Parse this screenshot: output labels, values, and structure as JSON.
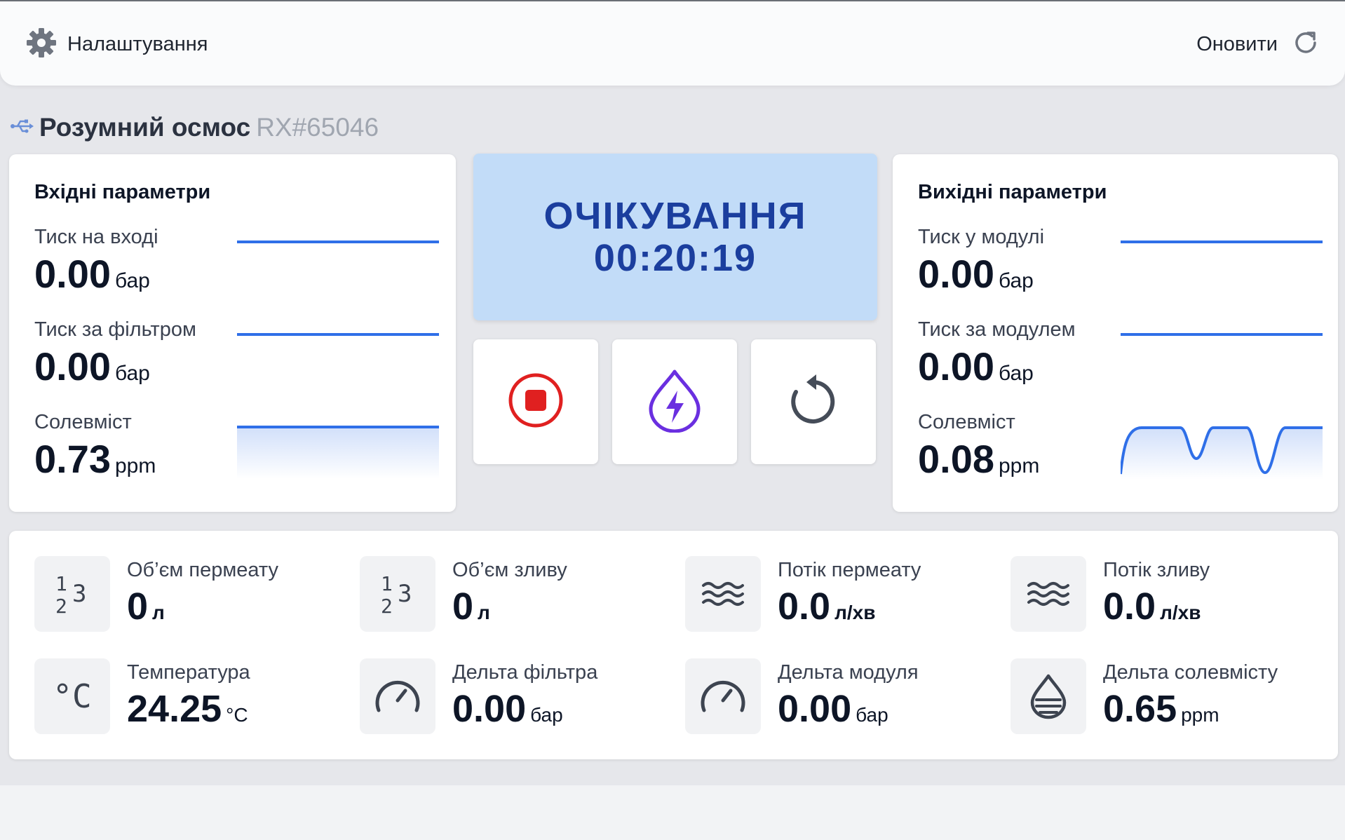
{
  "header": {
    "settings_label": "Налаштування",
    "refresh_label": "Оновити"
  },
  "device": {
    "name": "Розумний осмос",
    "id": "RX#65046"
  },
  "input_params": {
    "title": "Вхідні параметри",
    "items": [
      {
        "label": "Тиск на вході",
        "value": "0.00",
        "unit": "бар"
      },
      {
        "label": "Тиск за фільтром",
        "value": "0.00",
        "unit": "бар"
      },
      {
        "label": "Солевміст",
        "value": "0.73",
        "unit": "ppm"
      }
    ]
  },
  "output_params": {
    "title": "Вихідні параметри",
    "items": [
      {
        "label": "Тиск у модулі",
        "value": "0.00",
        "unit": "бар"
      },
      {
        "label": "Тиск за модулем",
        "value": "0.00",
        "unit": "бар"
      },
      {
        "label": "Солевміст",
        "value": "0.08",
        "unit": "ppm"
      }
    ]
  },
  "status": {
    "state": "ОЧІКУВАННЯ",
    "timer": "00:20:19"
  },
  "controls": [
    {
      "icon": "stop-circle-icon",
      "color": "#e02020"
    },
    {
      "icon": "flush-drop-bolt-icon",
      "color": "#6a2fe0"
    },
    {
      "icon": "reset-rotate-icon",
      "color": "#454c58"
    }
  ],
  "metrics": [
    {
      "icon": "counter-123-icon",
      "icon_text": "123",
      "label": "Об’єм пермеату",
      "value": "0",
      "unit": "л"
    },
    {
      "icon": "counter-123-icon",
      "icon_text": "123",
      "label": "Об’єм зливу",
      "value": "0",
      "unit": "л"
    },
    {
      "icon": "waves-icon",
      "label": "Потік пермеату",
      "value": "0.0",
      "unit": "л/хв"
    },
    {
      "icon": "waves-icon",
      "label": "Потік зливу",
      "value": "0.0",
      "unit": "л/хв"
    },
    {
      "icon": "thermometer-celsius-icon",
      "icon_text": "°C",
      "label": "Температура",
      "value": "24.25",
      "unit": "°C"
    },
    {
      "icon": "gauge-icon",
      "label": "Дельта фільтра",
      "value": "0.00",
      "unit": "бар"
    },
    {
      "icon": "gauge-icon",
      "label": "Дельта модуля",
      "value": "0.00",
      "unit": "бар"
    },
    {
      "icon": "water-drop-icon",
      "label": "Дельта солевмісту",
      "value": "0.65",
      "unit": "ppm"
    }
  ],
  "colors": {
    "accent": "#1b3e9e",
    "status_bg": "#c2dcf8",
    "sparkline": "#2f6fe8",
    "stop": "#e02020",
    "flush": "#6a2fe0"
  }
}
